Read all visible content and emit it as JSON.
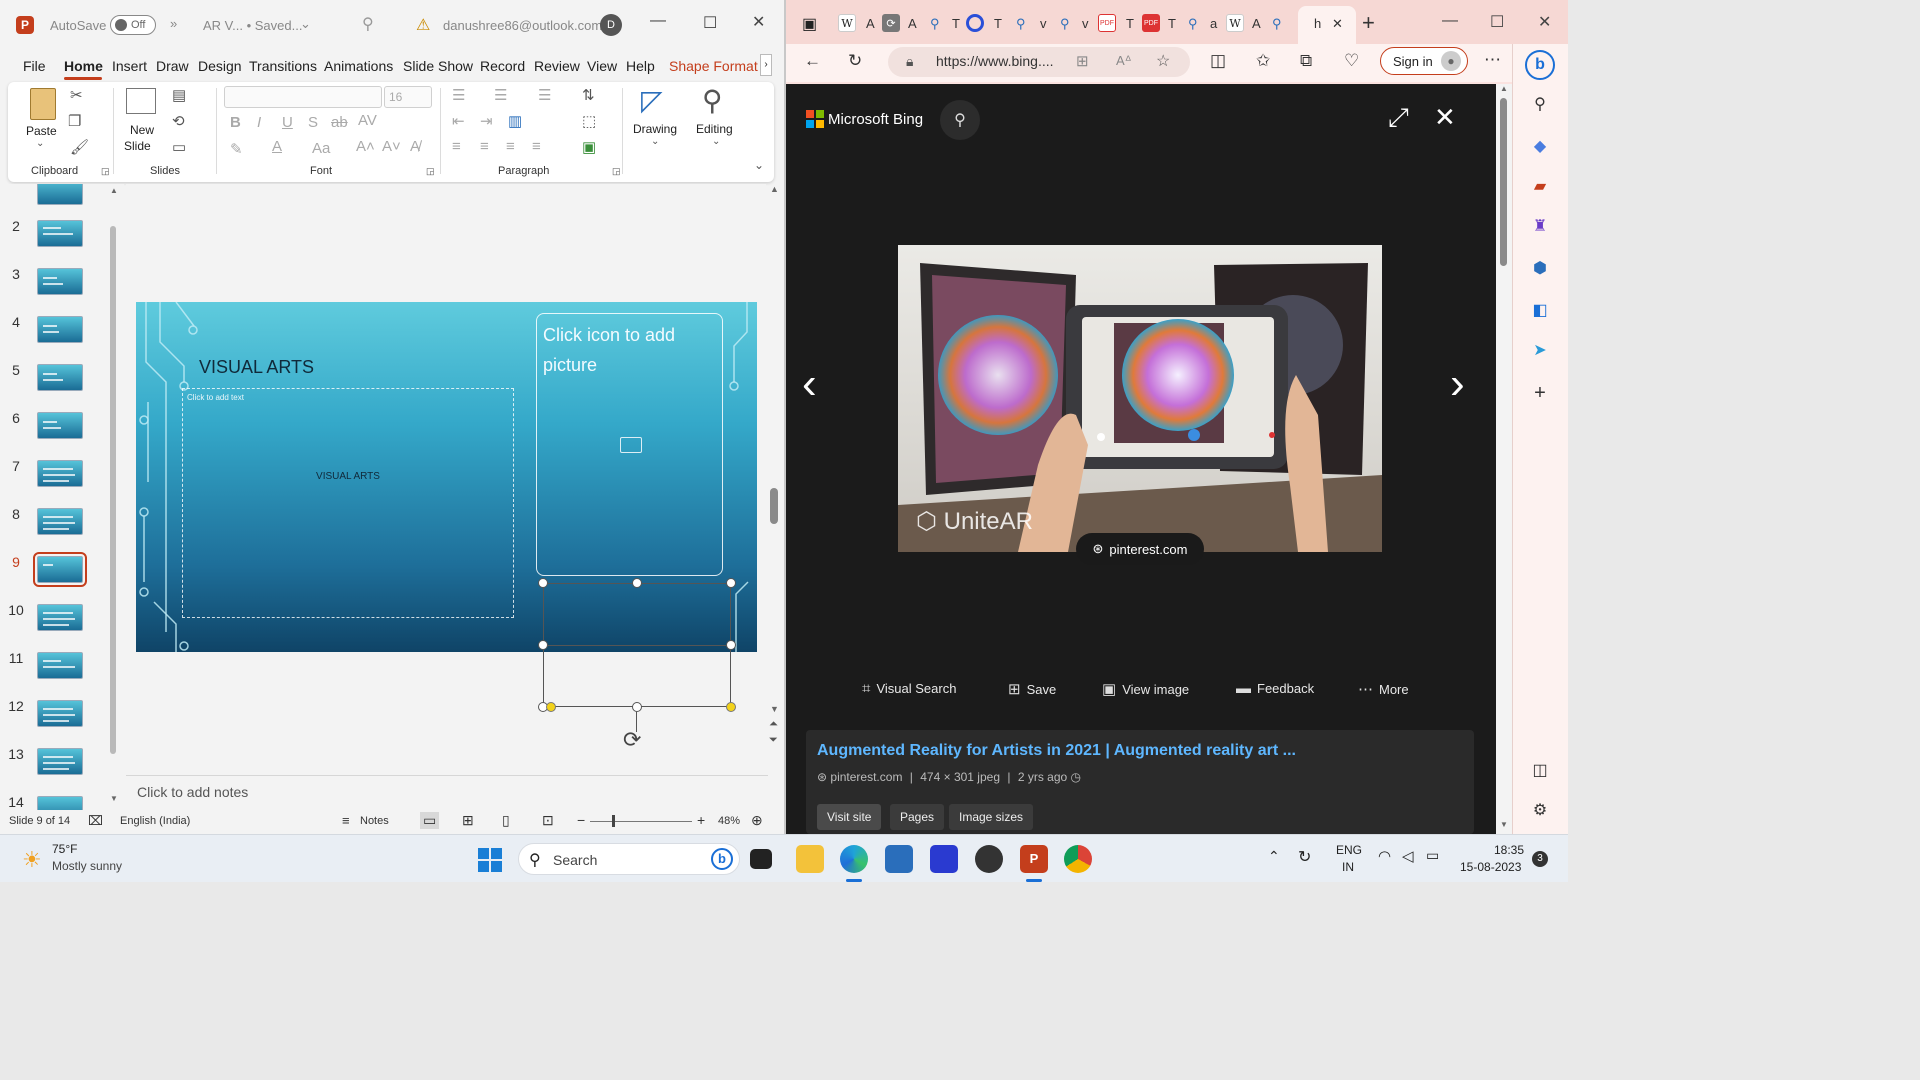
{
  "powerpoint": {
    "autosave_label": "AutoSave",
    "autosave_state": "Off",
    "doc_title": "AR V... • Saved...",
    "account": "danushree86@outlook.com",
    "avatar_initial": "D",
    "menu": [
      "File",
      "Home",
      "Insert",
      "Draw",
      "Design",
      "Transitions",
      "Animations",
      "Slide Show",
      "Record",
      "Review",
      "View",
      "Help",
      "Shape Format"
    ],
    "ribbon": {
      "paste": "Paste",
      "new_slide_1": "New",
      "new_slide_2": "Slide",
      "font_size": "16",
      "drawing": "Drawing",
      "editing": "Editing",
      "groups": [
        "Clipboard",
        "Slides",
        "Font",
        "Paragraph"
      ]
    },
    "slide_numbers": [
      "2",
      "3",
      "4",
      "5",
      "6",
      "7",
      "8",
      "9",
      "10",
      "11",
      "12",
      "13",
      "14"
    ],
    "selected_slide": "9",
    "slide": {
      "title": "VISUAL ARTS",
      "placeholder_hint": "Click to add text",
      "body_text": "VISUAL ARTS",
      "picture_prompt": "Click icon to add picture"
    },
    "notes_placeholder": "Click to add notes",
    "status": {
      "slide_count": "Slide 9 of 14",
      "language": "English (India)",
      "notes": "Notes",
      "zoom": "48%"
    }
  },
  "edge": {
    "tab_letters": [
      "A",
      "A",
      "T",
      "T",
      "v",
      "v",
      "T",
      "T",
      "a",
      "A",
      "h"
    ],
    "url": "https://www.bing....",
    "sign_in": "Sign in",
    "bing_brand": "Microsoft Bing",
    "image_source": "pinterest.com",
    "image_watermark": "UniteAR",
    "actions": [
      "Visual Search",
      "Save",
      "View image",
      "Feedback",
      "More"
    ],
    "result": {
      "title": "Augmented Reality for Artists in 2021 | Augmented reality art ...",
      "site": "pinterest.com",
      "size": "474 × 301 jpeg",
      "age": "2 yrs ago"
    },
    "pills": [
      "Visit site",
      "Pages",
      "Image sizes"
    ]
  },
  "taskbar": {
    "weather_temp": "75°F",
    "weather_desc": "Mostly sunny",
    "search": "Search",
    "lang_1": "ENG",
    "lang_2": "IN",
    "time": "18:35",
    "date": "15-08-2023",
    "notification_count": "3"
  },
  "colors": {
    "ppt_accent": "#c43e1c",
    "bing_link": "#5eb7ff",
    "edge_frame": "#fbe3e0"
  }
}
